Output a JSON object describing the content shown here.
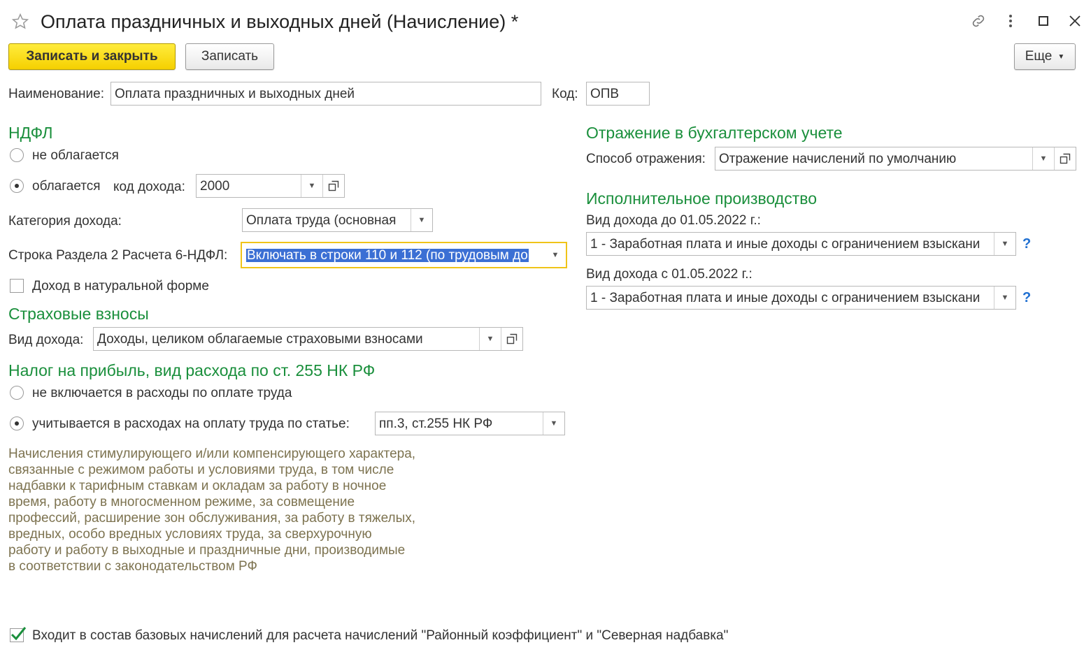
{
  "window": {
    "title": "Оплата праздничных и выходных дней (Начисление) *"
  },
  "toolbar": {
    "save_close_label": "Записать и закрыть",
    "save_label": "Записать",
    "more_label": "Еще"
  },
  "header": {
    "name_label": "Наименование:",
    "name_value": "Оплата праздничных и выходных дней",
    "code_label": "Код:",
    "code_value": "ОПВ"
  },
  "ndfl": {
    "section_title": "НДФЛ",
    "not_taxed_label": "не облагается",
    "taxed_label": "облагается",
    "income_code_label": "код дохода:",
    "income_code_value": "2000",
    "category_label": "Категория дохода:",
    "category_value": "Оплата труда (основная",
    "line_label": "Строка Раздела 2 Расчета 6-НДФЛ:",
    "line_value": "Включать в строки 110 и 112 (по трудовым до",
    "in_kind_label": "Доход в натуральной форме",
    "selected": "taxed"
  },
  "insurance": {
    "section_title": "Страховые взносы",
    "income_type_label": "Вид дохода:",
    "income_type_value": "Доходы, целиком облагаемые страховыми взносами"
  },
  "profit_tax": {
    "section_title": "Налог на прибыль, вид расхода по ст. 255 НК РФ",
    "excluded_label": "не включается в расходы по оплате труда",
    "included_label": "учитывается в расходах на оплату труда по статье:",
    "article_value": "пп.3, ст.255 НК РФ",
    "selected": "included",
    "note_lines": [
      "Начисления стимулирующего и/или компенсирующего характера,",
      "связанные с режимом работы и условиями труда, в том числе",
      "надбавки к тарифным ставкам и окладам за работу в ночное",
      "время, работу в многосменном режиме, за совмещение",
      "профессий, расширение зон обслуживания, за работу в тяжелых,",
      "вредных, особо вредных условиях труда, за сверхурочную",
      "работу и работу в выходные и праздничные дни, производимые",
      "в соответствии с законодательством РФ"
    ]
  },
  "accounting": {
    "section_title": "Отражение в бухгалтерском учете",
    "method_label": "Способ отражения:",
    "method_value": "Отражение начислений по умолчанию"
  },
  "enforcement": {
    "section_title": "Исполнительное производство",
    "before_label": "Вид дохода до 01.05.2022 г.:",
    "before_value": "1 - Заработная плата и иные доходы с ограничением взыскани",
    "after_label": "Вид дохода с 01.05.2022 г.:",
    "after_value": "1 - Заработная плата и иные доходы с ограничением взыскани",
    "help_symbol": "?"
  },
  "footer": {
    "base_accruals_label": "Входит в состав базовых начислений для расчета начислений \"Районный коэффициент\" и \"Северная надбавка\"",
    "base_accruals_checked": true
  },
  "icons": {
    "favorite": "star-icon",
    "link": "link-icon",
    "menu": "more-vertical-icon",
    "maximize": "maximize-icon",
    "close": "close-icon",
    "dropdown": "chevron-down-icon",
    "open": "open-form-icon"
  }
}
